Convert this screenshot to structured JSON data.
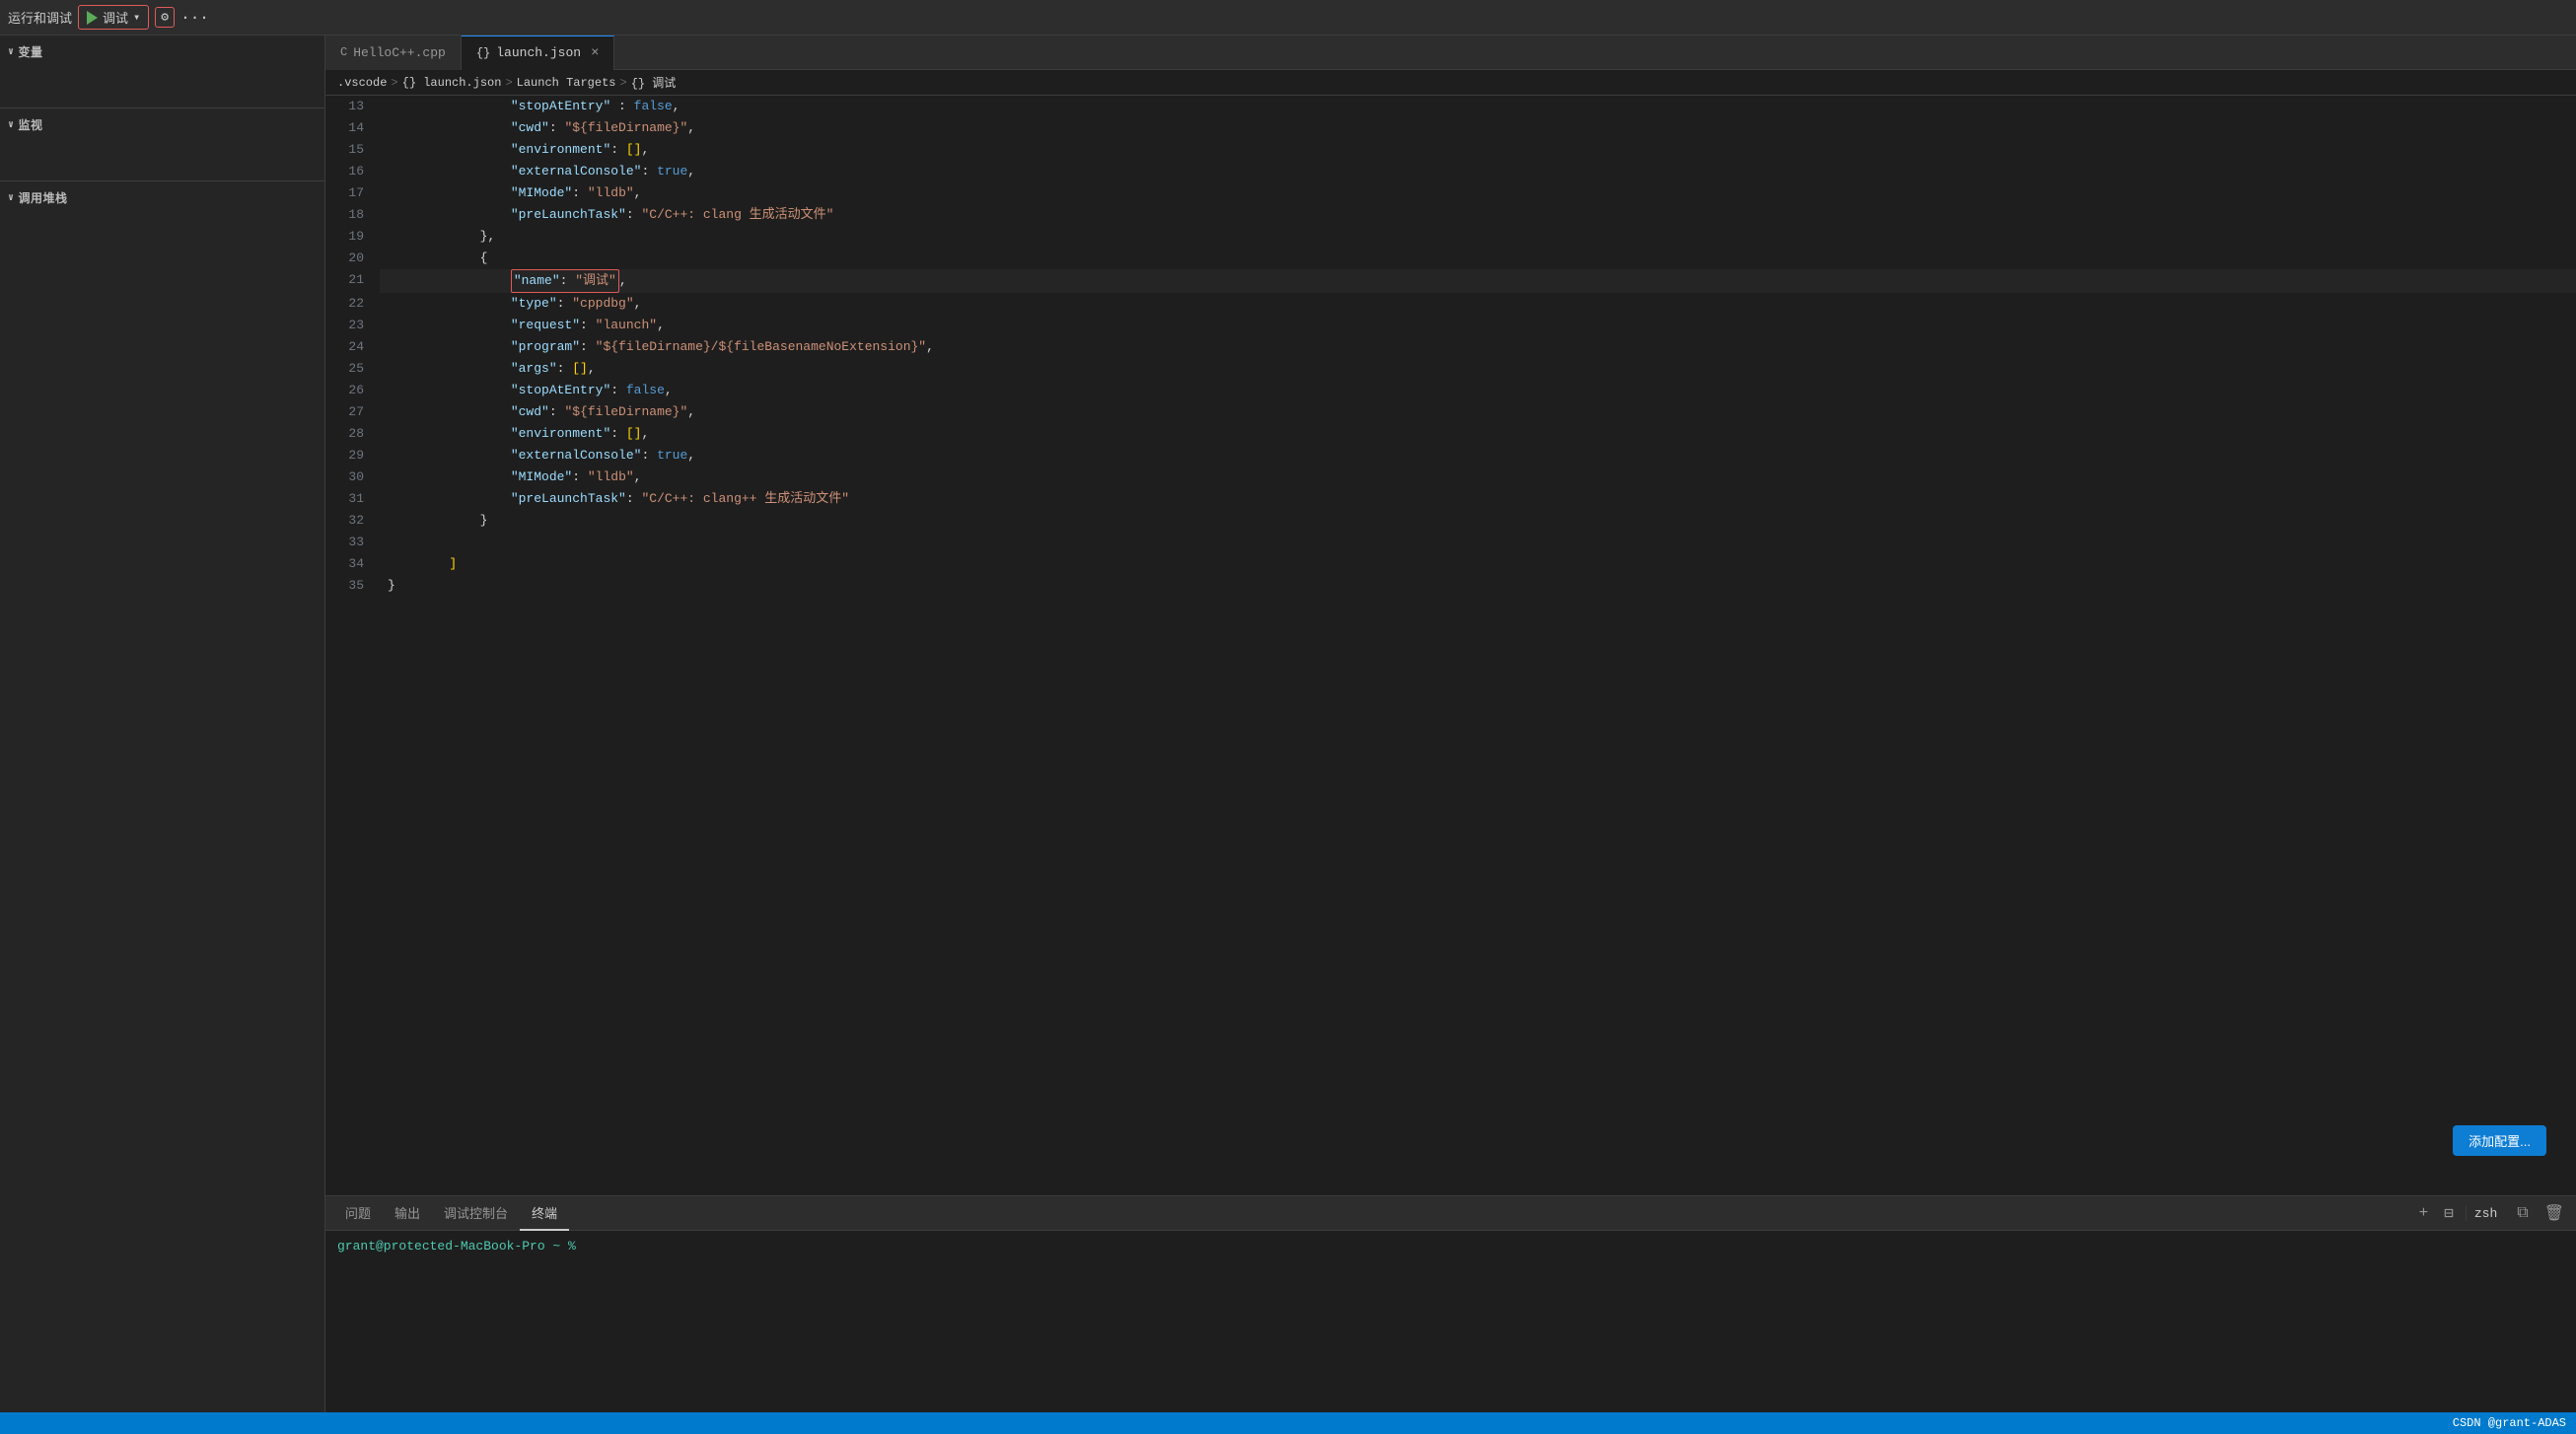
{
  "toolbar": {
    "label": "运行和调试",
    "debug_name": "调试",
    "play_title": "运行",
    "gear_title": "设置",
    "dots_title": "更多"
  },
  "sidebar": {
    "variables_label": "变量",
    "watch_label": "监视",
    "callstack_label": "调用堆栈"
  },
  "tabs": [
    {
      "id": "helloCpp",
      "icon": "C++",
      "label": "HelloC++.cpp",
      "active": false,
      "closable": false
    },
    {
      "id": "launchJson",
      "icon": "{}",
      "label": "launch.json",
      "active": true,
      "closable": true
    }
  ],
  "breadcrumb": {
    "parts": [
      ".vscode",
      "> {} launch.json",
      "> Launch Targets",
      "> {} 调试"
    ]
  },
  "code_lines": [
    {
      "num": "13",
      "tokens": [
        {
          "t": "                ",
          "c": ""
        },
        {
          "t": "\"stopAtEntry\"",
          "c": "c-key"
        },
        {
          "t": " : ",
          "c": "c-punct"
        },
        {
          "t": "false",
          "c": "c-bool"
        },
        {
          "t": ",",
          "c": "c-punct"
        }
      ]
    },
    {
      "num": "14",
      "tokens": [
        {
          "t": "                ",
          "c": ""
        },
        {
          "t": "\"cwd\"",
          "c": "c-key"
        },
        {
          "t": ": ",
          "c": "c-punct"
        },
        {
          "t": "\"${fileDirname}\"",
          "c": "c-str"
        },
        {
          "t": ",",
          "c": "c-punct"
        }
      ]
    },
    {
      "num": "15",
      "tokens": [
        {
          "t": "                ",
          "c": ""
        },
        {
          "t": "\"environment\"",
          "c": "c-key"
        },
        {
          "t": ": ",
          "c": "c-punct"
        },
        {
          "t": "[]",
          "c": "c-bracket"
        },
        {
          "t": ",",
          "c": "c-punct"
        }
      ]
    },
    {
      "num": "16",
      "tokens": [
        {
          "t": "                ",
          "c": ""
        },
        {
          "t": "\"externalConsole\"",
          "c": "c-key"
        },
        {
          "t": ": ",
          "c": "c-punct"
        },
        {
          "t": "true",
          "c": "c-bool"
        },
        {
          "t": ",",
          "c": "c-punct"
        }
      ]
    },
    {
      "num": "17",
      "tokens": [
        {
          "t": "                ",
          "c": ""
        },
        {
          "t": "\"MIMode\"",
          "c": "c-key"
        },
        {
          "t": ": ",
          "c": "c-punct"
        },
        {
          "t": "\"lldb\"",
          "c": "c-str"
        },
        {
          "t": ",",
          "c": "c-punct"
        }
      ]
    },
    {
      "num": "18",
      "tokens": [
        {
          "t": "                ",
          "c": ""
        },
        {
          "t": "\"preLaunchTask\"",
          "c": "c-key"
        },
        {
          "t": ": ",
          "c": "c-punct"
        },
        {
          "t": "\"C/C++: clang 生成活动文件\"",
          "c": "c-str"
        }
      ]
    },
    {
      "num": "19",
      "tokens": [
        {
          "t": "            ",
          "c": ""
        },
        {
          "t": "},",
          "c": "c-punct"
        }
      ]
    },
    {
      "num": "20",
      "tokens": [
        {
          "t": "            ",
          "c": ""
        },
        {
          "t": "{",
          "c": "c-punct"
        }
      ]
    },
    {
      "num": "21",
      "highlighted": true,
      "tokens": [
        {
          "t": "                ",
          "c": ""
        },
        {
          "t": "\"name\"",
          "c": "c-key name-box-start"
        },
        {
          "t": ": ",
          "c": "c-punct name-box-mid"
        },
        {
          "t": "\"调试\"",
          "c": "c-str name-box-end"
        },
        {
          "t": ",",
          "c": "c-punct"
        }
      ]
    },
    {
      "num": "22",
      "tokens": [
        {
          "t": "                ",
          "c": ""
        },
        {
          "t": "\"type\"",
          "c": "c-key"
        },
        {
          "t": ": ",
          "c": "c-punct"
        },
        {
          "t": "\"cppdbg\"",
          "c": "c-str"
        },
        {
          "t": ",",
          "c": "c-punct"
        }
      ]
    },
    {
      "num": "23",
      "tokens": [
        {
          "t": "                ",
          "c": ""
        },
        {
          "t": "\"request\"",
          "c": "c-key"
        },
        {
          "t": ": ",
          "c": "c-punct"
        },
        {
          "t": "\"launch\"",
          "c": "c-str"
        },
        {
          "t": ",",
          "c": "c-punct"
        }
      ]
    },
    {
      "num": "24",
      "tokens": [
        {
          "t": "                ",
          "c": ""
        },
        {
          "t": "\"program\"",
          "c": "c-key"
        },
        {
          "t": ": ",
          "c": "c-punct"
        },
        {
          "t": "\"${fileDirname}/${fileBasenameNoExtension}\"",
          "c": "c-str"
        },
        {
          "t": ",",
          "c": "c-punct"
        }
      ]
    },
    {
      "num": "25",
      "tokens": [
        {
          "t": "                ",
          "c": ""
        },
        {
          "t": "\"args\"",
          "c": "c-key"
        },
        {
          "t": ": ",
          "c": "c-punct"
        },
        {
          "t": "[]",
          "c": "c-bracket"
        },
        {
          "t": ",",
          "c": "c-punct"
        }
      ]
    },
    {
      "num": "26",
      "tokens": [
        {
          "t": "                ",
          "c": ""
        },
        {
          "t": "\"stopAtEntry\"",
          "c": "c-key"
        },
        {
          "t": ": ",
          "c": "c-punct"
        },
        {
          "t": "false",
          "c": "c-bool"
        },
        {
          "t": ",",
          "c": "c-punct"
        }
      ]
    },
    {
      "num": "27",
      "tokens": [
        {
          "t": "                ",
          "c": ""
        },
        {
          "t": "\"cwd\"",
          "c": "c-key"
        },
        {
          "t": ": ",
          "c": "c-punct"
        },
        {
          "t": "\"${fileDirname}\"",
          "c": "c-str"
        },
        {
          "t": ",",
          "c": "c-punct"
        }
      ]
    },
    {
      "num": "28",
      "tokens": [
        {
          "t": "                ",
          "c": ""
        },
        {
          "t": "\"environment\"",
          "c": "c-key"
        },
        {
          "t": ": ",
          "c": "c-punct"
        },
        {
          "t": "[]",
          "c": "c-bracket"
        },
        {
          "t": ",",
          "c": "c-punct"
        }
      ]
    },
    {
      "num": "29",
      "tokens": [
        {
          "t": "                ",
          "c": ""
        },
        {
          "t": "\"externalConsole\"",
          "c": "c-key"
        },
        {
          "t": ": ",
          "c": "c-punct"
        },
        {
          "t": "true",
          "c": "c-bool"
        },
        {
          "t": ",",
          "c": "c-punct"
        }
      ]
    },
    {
      "num": "30",
      "tokens": [
        {
          "t": "                ",
          "c": ""
        },
        {
          "t": "\"MIMode\"",
          "c": "c-key"
        },
        {
          "t": ": ",
          "c": "c-punct"
        },
        {
          "t": "\"lldb\"",
          "c": "c-str"
        },
        {
          "t": ",",
          "c": "c-punct"
        }
      ]
    },
    {
      "num": "31",
      "tokens": [
        {
          "t": "                ",
          "c": ""
        },
        {
          "t": "\"preLaunchTask\"",
          "c": "c-key"
        },
        {
          "t": ": ",
          "c": "c-punct"
        },
        {
          "t": "\"C/C++: clang++ 生成活动文件\"",
          "c": "c-str"
        }
      ]
    },
    {
      "num": "32",
      "tokens": [
        {
          "t": "            ",
          "c": ""
        },
        {
          "t": "}",
          "c": "c-punct"
        }
      ]
    },
    {
      "num": "33",
      "tokens": []
    },
    {
      "num": "34",
      "tokens": [
        {
          "t": "        ",
          "c": ""
        },
        {
          "t": "]",
          "c": "c-bracket"
        }
      ]
    },
    {
      "num": "35",
      "tokens": [
        {
          "t": "}",
          "c": "c-punct"
        }
      ]
    }
  ],
  "panel_tabs": [
    {
      "id": "problems",
      "label": "问题",
      "active": false
    },
    {
      "id": "output",
      "label": "输出",
      "active": false
    },
    {
      "id": "debug_console",
      "label": "调试控制台",
      "active": false
    },
    {
      "id": "terminal",
      "label": "终端",
      "active": true
    }
  ],
  "panel_actions": {
    "plus": "+",
    "split": "⊟",
    "zsh_label": "zsh",
    "icon_split": "⧉",
    "icon_trash": "🗑"
  },
  "terminal_prompt": "grant@protected-MacBook-Pro ~ % ",
  "add_config_btn": "添加配置...",
  "status_bar": {
    "csdn_label": "CSDN @grant-ADAS"
  }
}
